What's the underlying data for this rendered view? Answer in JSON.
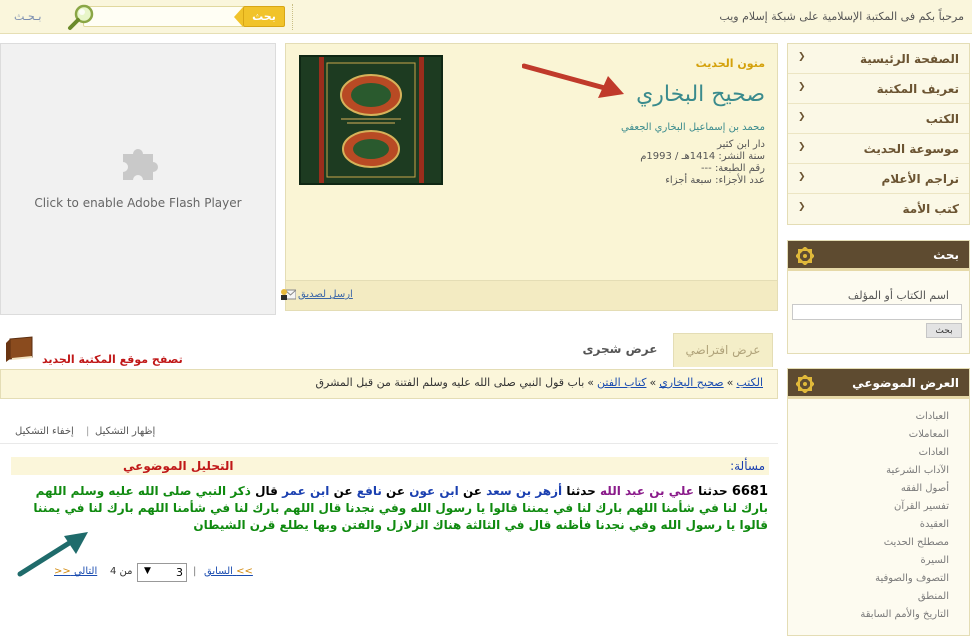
{
  "topbar": {
    "welcome": "مرحباً بكم فى المكتبة الإسلامية على شبكة إسلام ويب",
    "search_tag": "بحث",
    "search_label": "بـحـث"
  },
  "sidebar": {
    "menu": [
      {
        "label": "الصفحة الرئيسية"
      },
      {
        "label": "تعريف المكتبة"
      },
      {
        "label": "الكتب"
      },
      {
        "label": "موسوعة الحديث"
      },
      {
        "label": "تراجم الأعلام"
      },
      {
        "label": "كتب الأمة"
      }
    ],
    "search_panel": {
      "title": "بحث",
      "caption": "اسم الكتاب أو المؤلف",
      "input_value": "",
      "button": "بحث"
    },
    "topics_panel": {
      "title": "العرض الموضوعي",
      "items": [
        "العبادات",
        "المعاملات",
        "العادات",
        "الآداب الشرعية",
        "أصول الفقه",
        "تفسير القرآن",
        "العقيدة",
        "مصطلح الحديث",
        "السيرة",
        "التصوف والصوفية",
        "المنطق",
        "التاريخ والأمم السابقة"
      ]
    }
  },
  "book": {
    "category": "متون الحديث",
    "title": "صحيح البخاري",
    "author": "محمد بن إسماعيل البخاري الجعفي",
    "meta": [
      "دار ابن كثير",
      "سنة النشر: 1414هـ / 1993م",
      "رقم الطبعة: ---",
      "عدد الأجزاء: سبعة أجزاء"
    ],
    "send_friend": "ارسل لصديق"
  },
  "flash": {
    "message": "Click to enable Adobe Flash Player"
  },
  "tabs": {
    "virtual": "عرض افتراضي",
    "tree": "عرض شجرى",
    "new_site": "تصفح موقع المكتبة الجديد"
  },
  "breadcrumb": {
    "books": "الكتب",
    "book": "صحيح البخاري",
    "chapter": "كتاب الفتن",
    "current": "باب قول النبي صلى الله عليه وسلم الفتنة من قبل المشرق"
  },
  "diacritics": {
    "show": "إظهار التشكيل",
    "hide": "إخفاء التشكيل",
    "sep": "|"
  },
  "hadith": {
    "issue_label": "مسألة:",
    "analysis_label": "التحليل الموضوعي",
    "number": "6681",
    "t1": "حدثنا",
    "n1": "علي بن عبد الله",
    "t2": "حدثنا",
    "n2": "أزهر بن سعد",
    "t3": "عن",
    "n3": "ابن عون",
    "t4": "عن",
    "n4": "نافع",
    "t5": "عن",
    "n5": "ابن عمر",
    "t6": "قال",
    "matn": "ذكر النبي صلى الله عليه وسلم اللهم بارك لنا في شأمنا اللهم بارك لنا في يمننا قالوا يا رسول الله وفي نجدنا قال اللهم بارك لنا في شأمنا اللهم بارك لنا في يمننا قالوا يا رسول الله وفي نجدنا فأظنه قال في الثالثة هناك الزلازل والفتن وبها يطلع قرن الشيطان"
  },
  "pager": {
    "prev": "السابق",
    "next": "التالي",
    "prev_arrow": "<<",
    "next_arrow": ">>",
    "current": "3",
    "of_label": "من 4",
    "pipe": "|"
  },
  "colors": {
    "accent_gold": "#f1c32a",
    "panel_brown": "#5e4b30",
    "teal_title": "#3a8b8d",
    "link_blue": "#1a4cb0",
    "hadith_green": "#0f8a0f",
    "red": "#c01818"
  }
}
